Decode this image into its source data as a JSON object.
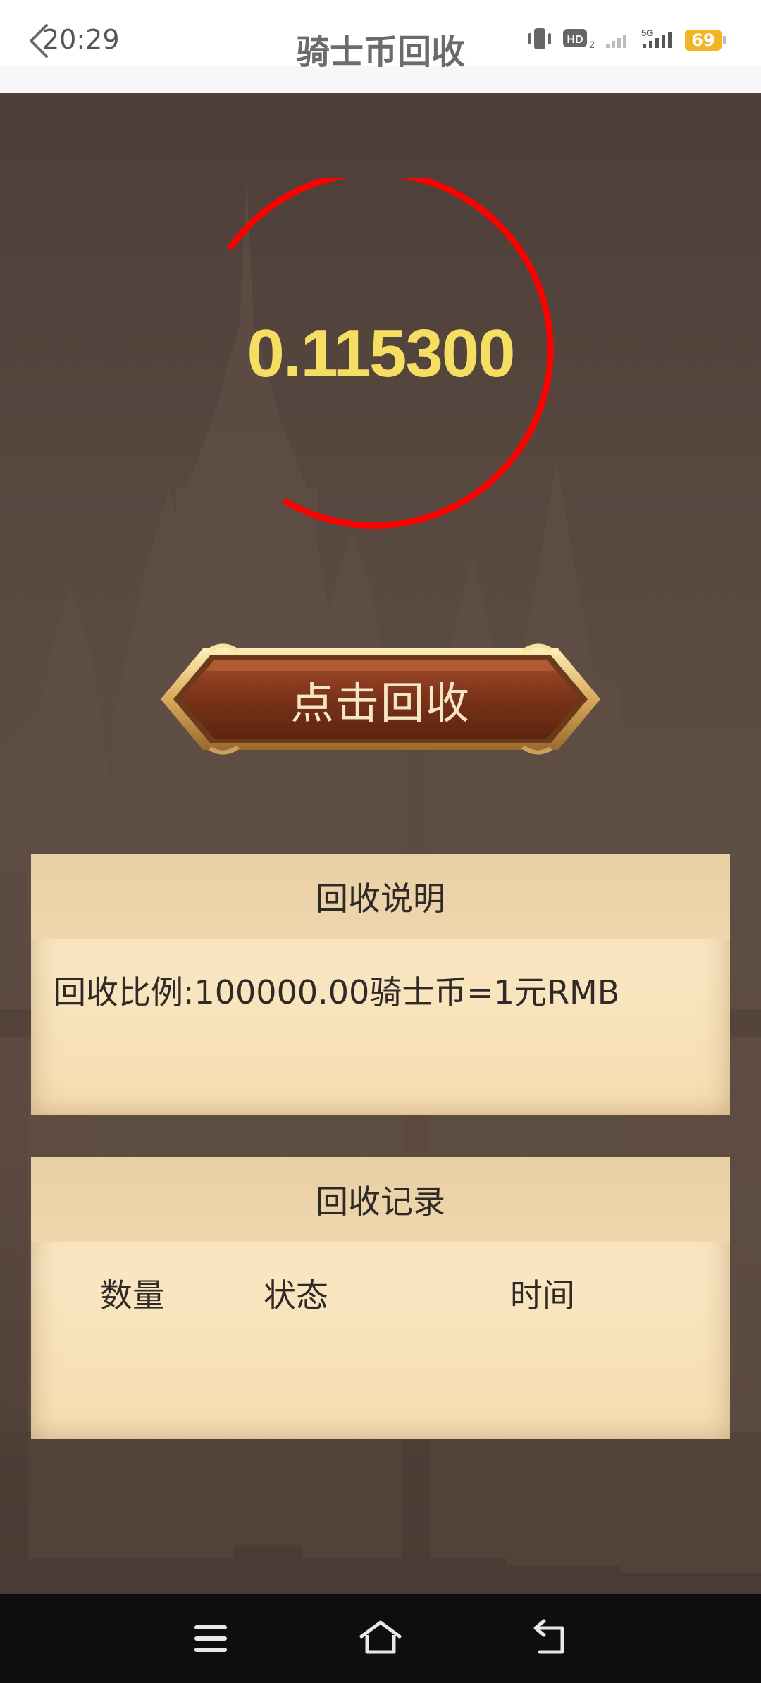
{
  "status_bar": {
    "time": "20:29",
    "battery": "69",
    "network": "5G",
    "hd_label": "HD"
  },
  "header": {
    "title": "骑士币回收"
  },
  "ring": {
    "value": "0.115300",
    "color": "#ff0000"
  },
  "actions": {
    "recycle_label": "点击回收"
  },
  "explain_panel": {
    "title": "回收说明",
    "rate_text": "回收比例:100000.00骑士币=1元RMB"
  },
  "records_panel": {
    "title": "回收记录",
    "columns": [
      "数量",
      "状态",
      "时间"
    ]
  },
  "colors": {
    "value_text": "#f6de63",
    "button_face": "#8a3e22",
    "button_gold": "#e8c479",
    "parchment": "#f6dfb4"
  }
}
